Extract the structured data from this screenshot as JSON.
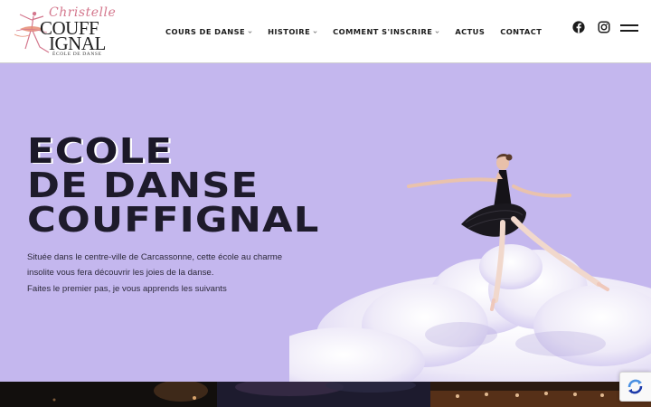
{
  "logo": {
    "script": "Christelle",
    "line1": "COUFF",
    "line2": "IGNAL",
    "subtitle": "ÉCOLE DE DANSE"
  },
  "nav": {
    "items": [
      {
        "label": "COURS DE DANSE",
        "has_dropdown": true
      },
      {
        "label": "HISTOIRE",
        "has_dropdown": true
      },
      {
        "label": "COMMENT S'INSCRIRE",
        "has_dropdown": true
      },
      {
        "label": "ACTUS",
        "has_dropdown": false
      },
      {
        "label": "CONTACT",
        "has_dropdown": false
      }
    ]
  },
  "header_icons": {
    "facebook": "facebook-icon",
    "instagram": "instagram-icon",
    "menu": "hamburger-menu-icon"
  },
  "hero": {
    "title_lines": [
      "ECOLE",
      "DE DANSE",
      "COUFFIGNAL"
    ],
    "paragraph_lines": [
      "Située dans le centre-ville de Carcassonne, cette école au charme",
      "insolite vous fera découvrir les joies de la danse.",
      "Faites le premier pas, je vous apprends les suivants"
    ],
    "background_color": "#c4b7ee",
    "title_color": "#1e1b2b"
  },
  "colors": {
    "accent_pink": "#d4778d",
    "header_bg": "#ffffff",
    "text_dark": "#1c1c1c"
  }
}
